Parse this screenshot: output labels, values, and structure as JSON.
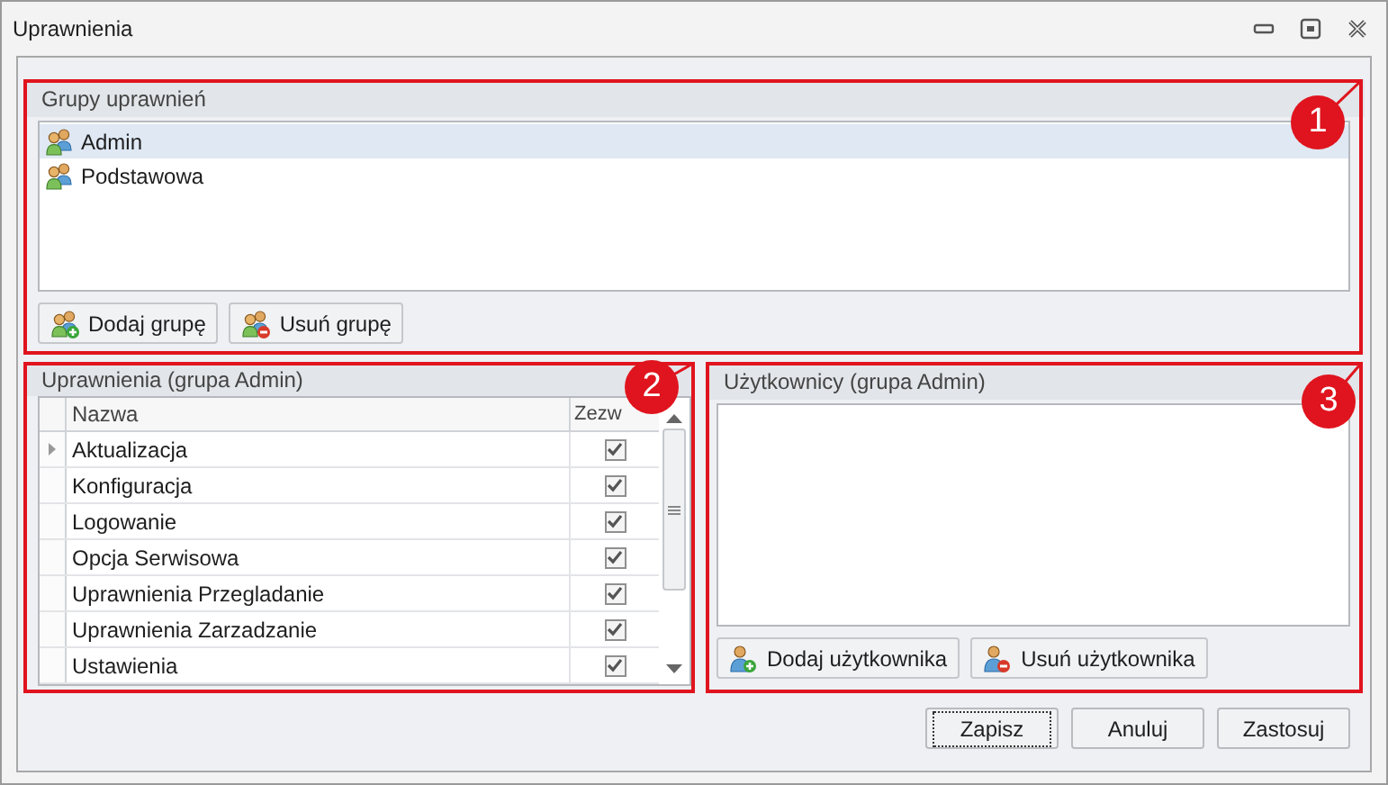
{
  "window": {
    "title": "Uprawnienia"
  },
  "groups_panel": {
    "title": "Grupy uprawnień",
    "items": [
      {
        "label": "Admin",
        "selected": true
      },
      {
        "label": "Podstawowa",
        "selected": false
      }
    ],
    "buttons": [
      {
        "label": "Dodaj grupę",
        "kind": "add"
      },
      {
        "label": "Usuń grupę",
        "kind": "remove"
      }
    ]
  },
  "permissions_panel": {
    "title": "Uprawnienia (grupa Admin)",
    "columns": [
      "Nazwa",
      "Zezw"
    ],
    "rows": [
      {
        "name": "Aktualizacja",
        "allowed": true,
        "current": true
      },
      {
        "name": "Konfiguracja",
        "allowed": true,
        "current": false
      },
      {
        "name": "Logowanie",
        "allowed": true,
        "current": false
      },
      {
        "name": "Opcja Serwisowa",
        "allowed": true,
        "current": false
      },
      {
        "name": "Uprawnienia Przegladanie",
        "allowed": true,
        "current": false
      },
      {
        "name": "Uprawnienia Zarzadzanie",
        "allowed": true,
        "current": false
      },
      {
        "name": "Ustawienia",
        "allowed": true,
        "current": false
      }
    ]
  },
  "users_panel": {
    "title": "Użytkownicy (grupa Admin)",
    "buttons": [
      {
        "label": "Dodaj użytkownika",
        "kind": "add"
      },
      {
        "label": "Usuń użytkownika",
        "kind": "remove"
      }
    ]
  },
  "buttons": [
    {
      "label": "Zapisz",
      "focused": true
    },
    {
      "label": "Anuluj",
      "focused": false
    },
    {
      "label": "Zastosuj",
      "focused": false
    }
  ],
  "callouts": [
    "1",
    "2",
    "3"
  ]
}
